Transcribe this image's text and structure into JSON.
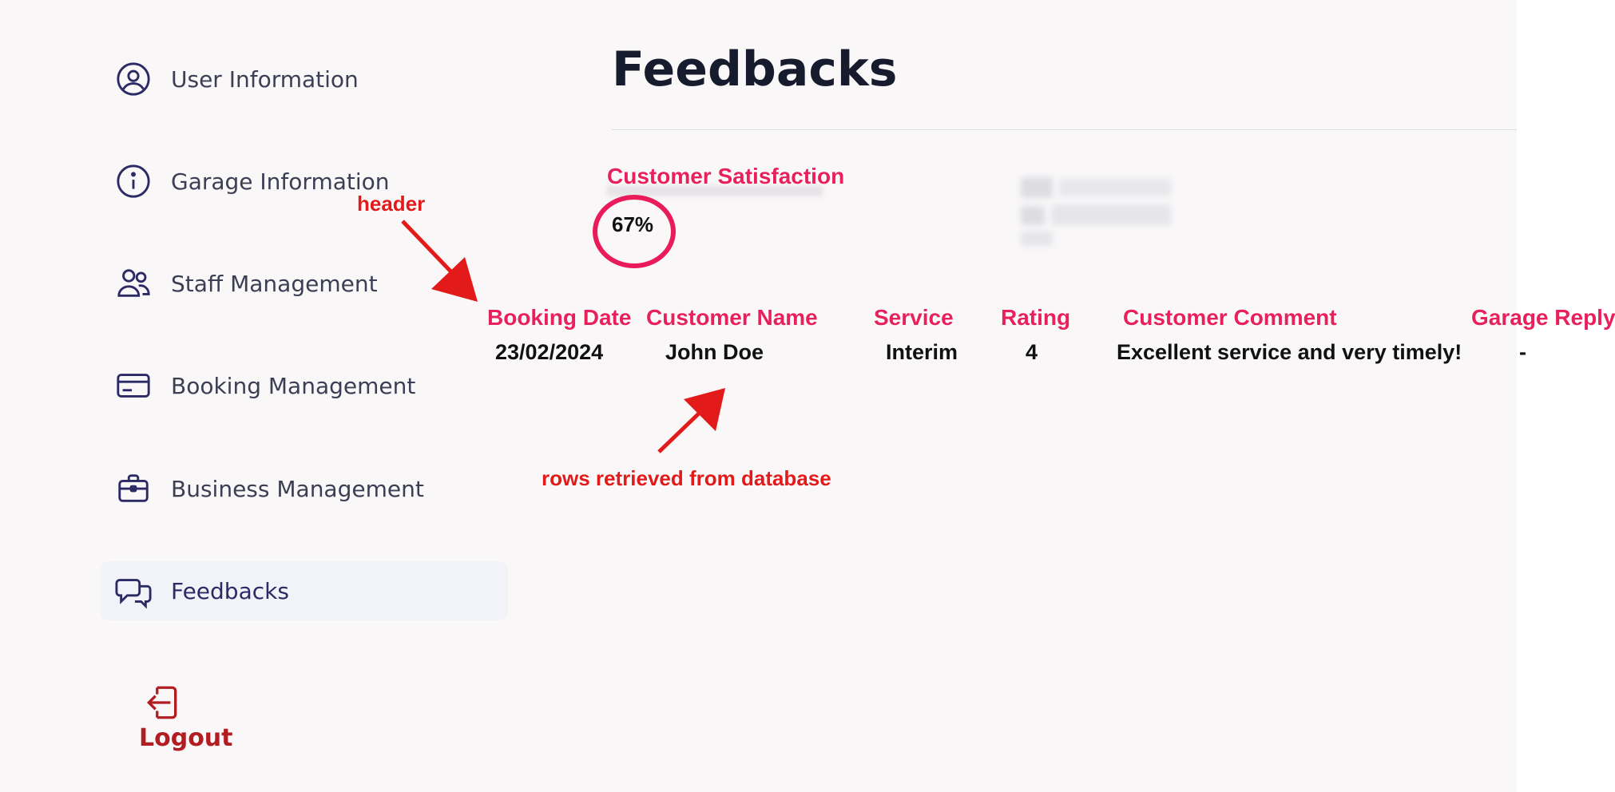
{
  "sidebar": {
    "items": [
      {
        "label": "User Information",
        "icon": "user-circle-icon"
      },
      {
        "label": "Garage Information",
        "icon": "info-circle-icon"
      },
      {
        "label": "Staff Management",
        "icon": "users-icon"
      },
      {
        "label": "Booking Management",
        "icon": "credit-card-icon"
      },
      {
        "label": "Business Management",
        "icon": "briefcase-icon"
      },
      {
        "label": "Feedbacks",
        "icon": "chat-bubbles-icon",
        "active": true
      }
    ],
    "logout_label": "Logout"
  },
  "main": {
    "title": "Feedbacks",
    "satisfaction_label": "Customer Satisfaction",
    "satisfaction_value": "67%",
    "table": {
      "headers": [
        "Booking Date",
        "Customer Name",
        "Service",
        "Rating",
        "Customer Comment",
        "Garage Reply"
      ],
      "rows": [
        [
          "23/02/2024",
          "John Doe",
          "Interim",
          "4",
          "Excellent service and very timely!",
          "-"
        ]
      ]
    }
  },
  "annotations": {
    "header_note": "header",
    "rows_note": "rows retrieved from database"
  },
  "colors": {
    "accent": "#2b2a64",
    "annotation_pink": "#e8205c",
    "annotation_red": "#e21a1a",
    "logout": "#b11d21"
  }
}
